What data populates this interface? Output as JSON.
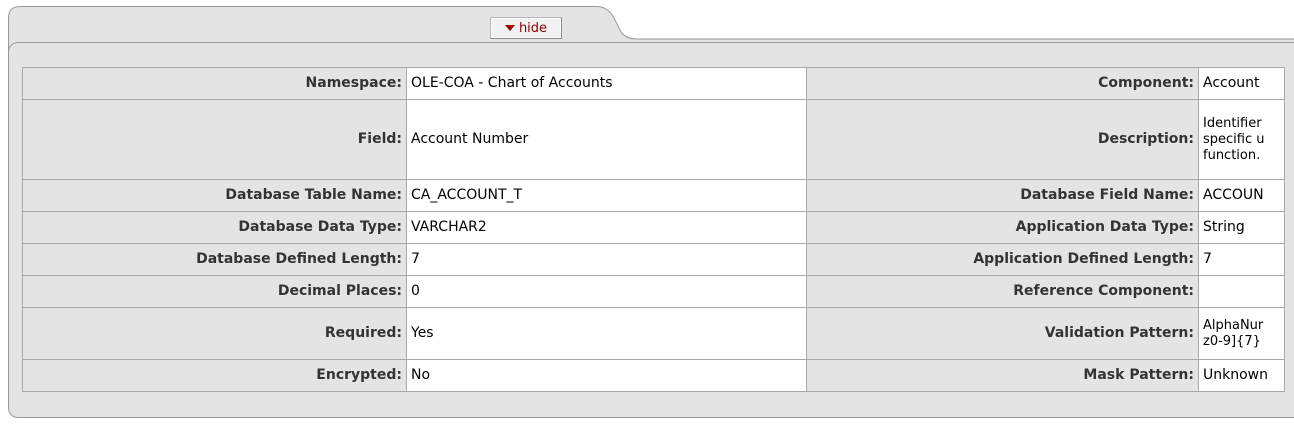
{
  "panel": {
    "hide_label": "hide"
  },
  "rows": [
    {
      "label_left": "Namespace:",
      "value_left": "OLE-COA - Chart of Accounts",
      "label_right": "Component:",
      "value_right": "Account"
    },
    {
      "label_left": "Field:",
      "value_left": "Account Number",
      "label_right": "Description:",
      "value_right": "Identifier specific u function."
    },
    {
      "label_left": "Database Table Name:",
      "value_left": "CA_ACCOUNT_T",
      "label_right": "Database Field Name:",
      "value_right": "ACCOUN"
    },
    {
      "label_left": "Database Data Type:",
      "value_left": "VARCHAR2",
      "label_right": "Application Data Type:",
      "value_right": "String"
    },
    {
      "label_left": "Database Defined Length:",
      "value_left": "7",
      "label_right": "Application Defined Length:",
      "value_right": "7"
    },
    {
      "label_left": "Decimal Places:",
      "value_left": "0",
      "label_right": "Reference Component:",
      "value_right": ""
    },
    {
      "label_left": "Required:",
      "value_left": "Yes",
      "label_right": "Validation Pattern:",
      "value_right": "AlphaNur z0-9]{7}"
    },
    {
      "label_left": "Encrypted:",
      "value_left": "No",
      "label_right": "Mask Pattern:",
      "value_right": "Unknown"
    }
  ],
  "colors": {
    "panel_bg": "#e4e4e4",
    "border": "#a8a8a8",
    "hide_text": "#8b0000"
  }
}
